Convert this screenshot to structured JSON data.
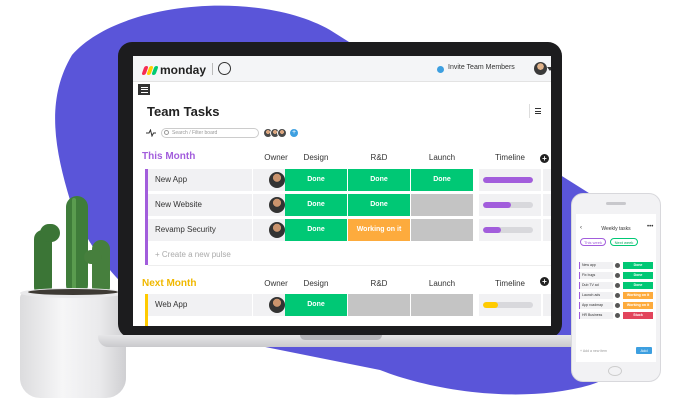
{
  "colors": {
    "blob": "#5a55d9",
    "done": "#00c875",
    "working": "#fdab3d",
    "stuck": "#e2445c",
    "empty": "#c4c4c4",
    "this_month": "#a25ddc",
    "next_month": "#ffcb00",
    "timeline_purple": "#a25ddc",
    "timeline_yellow": "#ffcb00",
    "accent_blue": "#3d9fe0"
  },
  "app": {
    "logo_text": "monday",
    "invite_label": "Invite Team Members",
    "board_title": "Team Tasks",
    "search_placeholder": "Search / Filter board",
    "new_pulse": "+ Create a new pulse"
  },
  "groups": [
    {
      "title": "This Month",
      "color": "#a25ddc",
      "columns": {
        "owner": "Owner",
        "design": "Design",
        "rd": "R&D",
        "launch": "Launch",
        "timeline": "Timeline"
      },
      "rows": [
        {
          "name": "New App",
          "design": "Done",
          "rd": "Done",
          "launch": "Done",
          "timeline": 1.0
        },
        {
          "name": "New Website",
          "design": "Done",
          "rd": "Done",
          "launch": "",
          "timeline": 0.55
        },
        {
          "name": "Revamp Security",
          "design": "Done",
          "rd": "Working on it",
          "launch": "",
          "timeline": 0.35
        }
      ]
    },
    {
      "title": "Next Month",
      "color": "#ffcb00",
      "columns": {
        "owner": "Owner",
        "design": "Design",
        "rd": "R&D",
        "launch": "Launch",
        "timeline": "Timeline"
      },
      "rows": [
        {
          "name": "Web App",
          "design": "Done",
          "rd": "",
          "launch": "",
          "timeline": 0.3
        }
      ]
    }
  ],
  "phone": {
    "title": "Weekly tasks",
    "pill_this_week": "This week",
    "pill_next_week": "Next week",
    "rows": [
      {
        "name": "New app",
        "status": "Done"
      },
      {
        "name": "Fix bugs",
        "status": "Done"
      },
      {
        "name": "Dub TV ad",
        "status": "Done"
      },
      {
        "name": "Launch ads",
        "status": "Working on it"
      },
      {
        "name": "App roadmap",
        "status": "Working on it"
      },
      {
        "name": "HR Business",
        "status": "Stuck"
      }
    ],
    "new_row_label": "+ Add a new item",
    "add_label": "Add"
  }
}
